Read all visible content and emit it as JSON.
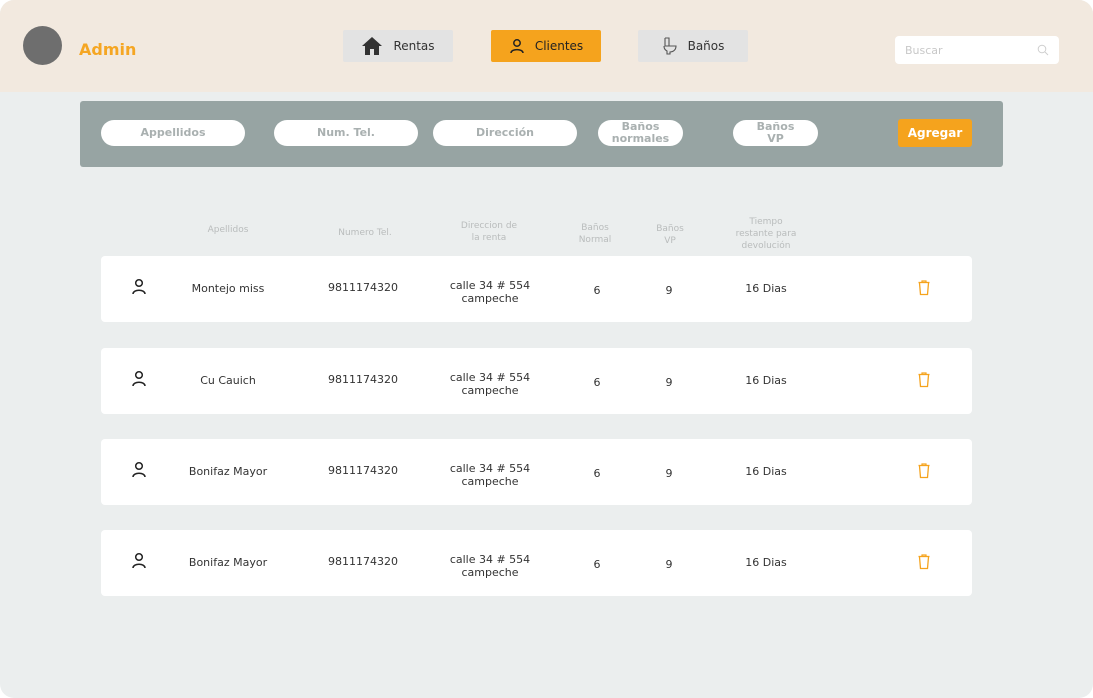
{
  "header": {
    "brand": "Admin",
    "nav": [
      {
        "label": "Rentas",
        "icon": "house-icon"
      },
      {
        "label": "Clientes",
        "icon": "user-icon",
        "active": true
      },
      {
        "label": "Baños",
        "icon": "toilet-icon"
      }
    ],
    "search_placeholder": "Buscar"
  },
  "form": {
    "apellidos": "Appellidos",
    "num_tel": "Num. Tel.",
    "direccion": "Dirección",
    "banos_normales_1": "Baños",
    "banos_normales_2": "normales",
    "banos_vp_1": "Baños",
    "banos_vp_2": "VP",
    "add_label": "Agregar"
  },
  "table": {
    "headers": {
      "apellidos": "Apellidos",
      "numero": "Numero Tel.",
      "direccion_1": "Direccion de",
      "direccion_2": "la renta",
      "banos_normal_1": "Baños",
      "banos_normal_2": "Normal",
      "banos_vp_1": "Baños",
      "banos_vp_2": "VP",
      "tiempo_1": "Tiempo",
      "tiempo_2": "restante para",
      "tiempo_3": "devolución"
    },
    "rows": [
      {
        "apellidos": "Montejo miss",
        "telefono": "9811174320",
        "direccion_1": "calle 34 # 554",
        "direccion_2": "campeche",
        "banos_normal": "6",
        "banos_vp": "9",
        "tiempo": "16 Dias"
      },
      {
        "apellidos": "Cu Cauich",
        "telefono": "9811174320",
        "direccion_1": "calle 34 # 554",
        "direccion_2": "campeche",
        "banos_normal": "6",
        "banos_vp": "9",
        "tiempo": "16 Dias"
      },
      {
        "apellidos": "Bonifaz Mayor",
        "telefono": "9811174320",
        "direccion_1": "calle 34 # 554",
        "direccion_2": "campeche",
        "banos_normal": "6",
        "banos_vp": "9",
        "tiempo": "16 Dias"
      },
      {
        "apellidos": "Bonifaz Mayor",
        "telefono": "9811174320",
        "direccion_1": "calle 34 # 554",
        "direccion_2": "campeche",
        "banos_normal": "6",
        "banos_vp": "9",
        "tiempo": "16 Dias"
      }
    ]
  },
  "colors": {
    "accent": "#f5a31d",
    "header_bg": "#f2e9df",
    "panel_bg": "#97a4a3",
    "page_bg": "#ebeeee"
  }
}
